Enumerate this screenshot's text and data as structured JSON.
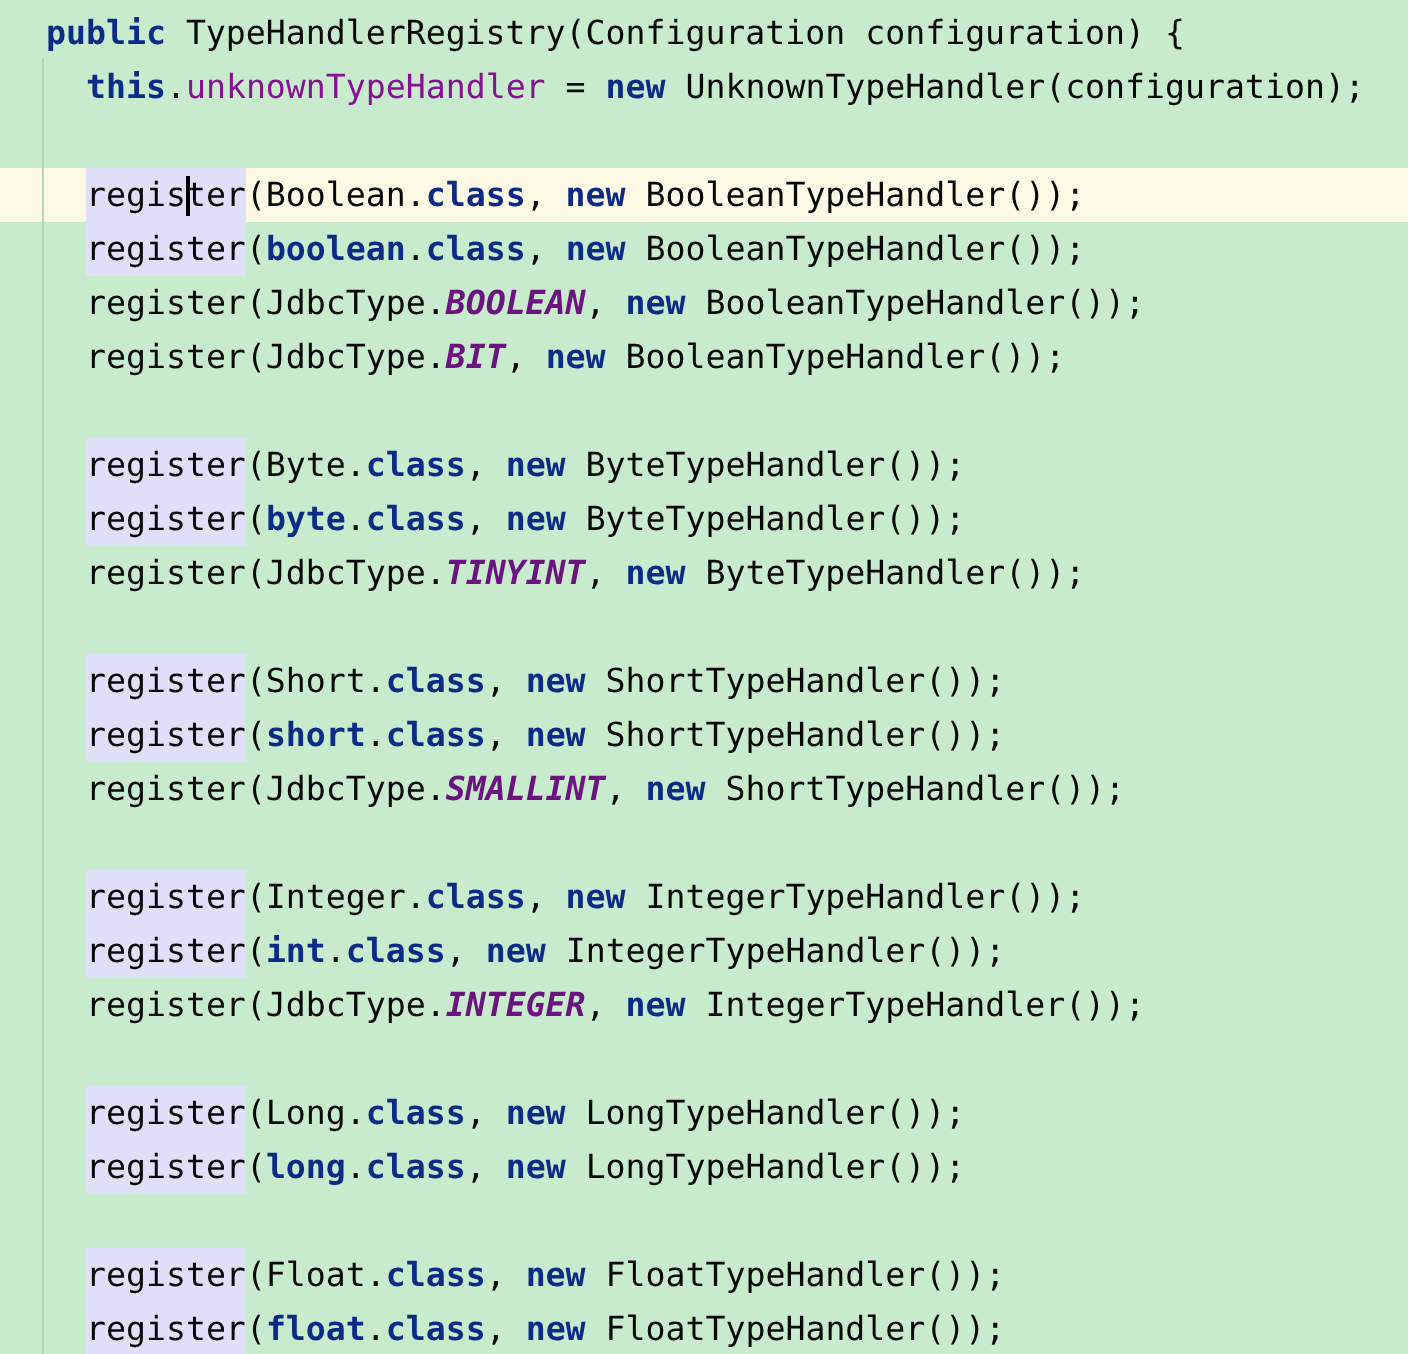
{
  "editor": {
    "signature": {
      "current": false,
      "tokens": [
        {
          "text": "public",
          "kind": "keyword"
        },
        {
          "text": " TypeHandlerRegistry(Configuration configuration) {",
          "kind": "plain"
        }
      ]
    },
    "body": [
      {
        "current": false,
        "call_highlighted": false,
        "tokens": [
          {
            "text": "this",
            "kind": "keyword"
          },
          {
            "text": ".",
            "kind": "plain"
          },
          {
            "text": "unknownTypeHandler",
            "kind": "field"
          },
          {
            "text": " = ",
            "kind": "plain"
          },
          {
            "text": "new",
            "kind": "keyword"
          },
          {
            "text": " UnknownTypeHandler(configuration);",
            "kind": "plain"
          }
        ]
      },
      {
        "current": false
      },
      {
        "current": true,
        "call_highlighted": true,
        "tokens": [
          {
            "text": "regis",
            "kind": "plain"
          },
          {
            "kind": "caret"
          },
          {
            "text": "ter",
            "kind": "plain"
          },
          {
            "text": "(Boolean.",
            "kind": "plain"
          },
          {
            "text": "class",
            "kind": "keyword"
          },
          {
            "text": ", ",
            "kind": "plain"
          },
          {
            "text": "new",
            "kind": "keyword"
          },
          {
            "text": " BooleanTypeHandler());",
            "kind": "plain"
          }
        ]
      },
      {
        "current": false,
        "call_highlighted": true,
        "tokens": [
          {
            "text": "register",
            "kind": "plain"
          },
          {
            "text": "(",
            "kind": "plain"
          },
          {
            "text": "boolean",
            "kind": "keyword"
          },
          {
            "text": ".",
            "kind": "plain"
          },
          {
            "text": "class",
            "kind": "keyword"
          },
          {
            "text": ", ",
            "kind": "plain"
          },
          {
            "text": "new",
            "kind": "keyword"
          },
          {
            "text": " BooleanTypeHandler());",
            "kind": "plain"
          }
        ]
      },
      {
        "current": false,
        "call_highlighted": false,
        "tokens": [
          {
            "text": "register",
            "kind": "plain"
          },
          {
            "text": "(JdbcType.",
            "kind": "plain"
          },
          {
            "text": "BOOLEAN",
            "kind": "constant"
          },
          {
            "text": ", ",
            "kind": "plain"
          },
          {
            "text": "new",
            "kind": "keyword"
          },
          {
            "text": " BooleanTypeHandler());",
            "kind": "plain"
          }
        ]
      },
      {
        "current": false,
        "call_highlighted": false,
        "tokens": [
          {
            "text": "register",
            "kind": "plain"
          },
          {
            "text": "(JdbcType.",
            "kind": "plain"
          },
          {
            "text": "BIT",
            "kind": "constant"
          },
          {
            "text": ", ",
            "kind": "plain"
          },
          {
            "text": "new",
            "kind": "keyword"
          },
          {
            "text": " BooleanTypeHandler());",
            "kind": "plain"
          }
        ]
      },
      {
        "current": false
      },
      {
        "current": false,
        "call_highlighted": true,
        "tokens": [
          {
            "text": "register",
            "kind": "plain"
          },
          {
            "text": "(Byte.",
            "kind": "plain"
          },
          {
            "text": "class",
            "kind": "keyword"
          },
          {
            "text": ", ",
            "kind": "plain"
          },
          {
            "text": "new",
            "kind": "keyword"
          },
          {
            "text": " ByteTypeHandler());",
            "kind": "plain"
          }
        ]
      },
      {
        "current": false,
        "call_highlighted": true,
        "tokens": [
          {
            "text": "register",
            "kind": "plain"
          },
          {
            "text": "(",
            "kind": "plain"
          },
          {
            "text": "byte",
            "kind": "keyword"
          },
          {
            "text": ".",
            "kind": "plain"
          },
          {
            "text": "class",
            "kind": "keyword"
          },
          {
            "text": ", ",
            "kind": "plain"
          },
          {
            "text": "new",
            "kind": "keyword"
          },
          {
            "text": " ByteTypeHandler());",
            "kind": "plain"
          }
        ]
      },
      {
        "current": false,
        "call_highlighted": false,
        "tokens": [
          {
            "text": "register",
            "kind": "plain"
          },
          {
            "text": "(JdbcType.",
            "kind": "plain"
          },
          {
            "text": "TINYINT",
            "kind": "constant"
          },
          {
            "text": ", ",
            "kind": "plain"
          },
          {
            "text": "new",
            "kind": "keyword"
          },
          {
            "text": " ByteTypeHandler());",
            "kind": "plain"
          }
        ]
      },
      {
        "current": false
      },
      {
        "current": false,
        "call_highlighted": true,
        "tokens": [
          {
            "text": "register",
            "kind": "plain"
          },
          {
            "text": "(Short.",
            "kind": "plain"
          },
          {
            "text": "class",
            "kind": "keyword"
          },
          {
            "text": ", ",
            "kind": "plain"
          },
          {
            "text": "new",
            "kind": "keyword"
          },
          {
            "text": " ShortTypeHandler());",
            "kind": "plain"
          }
        ]
      },
      {
        "current": false,
        "call_highlighted": true,
        "tokens": [
          {
            "text": "register",
            "kind": "plain"
          },
          {
            "text": "(",
            "kind": "plain"
          },
          {
            "text": "short",
            "kind": "keyword"
          },
          {
            "text": ".",
            "kind": "plain"
          },
          {
            "text": "class",
            "kind": "keyword"
          },
          {
            "text": ", ",
            "kind": "plain"
          },
          {
            "text": "new",
            "kind": "keyword"
          },
          {
            "text": " ShortTypeHandler());",
            "kind": "plain"
          }
        ]
      },
      {
        "current": false,
        "call_highlighted": false,
        "tokens": [
          {
            "text": "register",
            "kind": "plain"
          },
          {
            "text": "(JdbcType.",
            "kind": "plain"
          },
          {
            "text": "SMALLINT",
            "kind": "constant"
          },
          {
            "text": ", ",
            "kind": "plain"
          },
          {
            "text": "new",
            "kind": "keyword"
          },
          {
            "text": " ShortTypeHandler());",
            "kind": "plain"
          }
        ]
      },
      {
        "current": false
      },
      {
        "current": false,
        "call_highlighted": true,
        "tokens": [
          {
            "text": "register",
            "kind": "plain"
          },
          {
            "text": "(Integer.",
            "kind": "plain"
          },
          {
            "text": "class",
            "kind": "keyword"
          },
          {
            "text": ", ",
            "kind": "plain"
          },
          {
            "text": "new",
            "kind": "keyword"
          },
          {
            "text": " IntegerTypeHandler());",
            "kind": "plain"
          }
        ]
      },
      {
        "current": false,
        "call_highlighted": true,
        "tokens": [
          {
            "text": "register",
            "kind": "plain"
          },
          {
            "text": "(",
            "kind": "plain"
          },
          {
            "text": "int",
            "kind": "keyword"
          },
          {
            "text": ".",
            "kind": "plain"
          },
          {
            "text": "class",
            "kind": "keyword"
          },
          {
            "text": ", ",
            "kind": "plain"
          },
          {
            "text": "new",
            "kind": "keyword"
          },
          {
            "text": " IntegerTypeHandler());",
            "kind": "plain"
          }
        ]
      },
      {
        "current": false,
        "call_highlighted": false,
        "tokens": [
          {
            "text": "register",
            "kind": "plain"
          },
          {
            "text": "(JdbcType.",
            "kind": "plain"
          },
          {
            "text": "INTEGER",
            "kind": "constant"
          },
          {
            "text": ", ",
            "kind": "plain"
          },
          {
            "text": "new",
            "kind": "keyword"
          },
          {
            "text": " IntegerTypeHandler());",
            "kind": "plain"
          }
        ]
      },
      {
        "current": false
      },
      {
        "current": false,
        "call_highlighted": true,
        "tokens": [
          {
            "text": "register",
            "kind": "plain"
          },
          {
            "text": "(Long.",
            "kind": "plain"
          },
          {
            "text": "class",
            "kind": "keyword"
          },
          {
            "text": ", ",
            "kind": "plain"
          },
          {
            "text": "new",
            "kind": "keyword"
          },
          {
            "text": " LongTypeHandler());",
            "kind": "plain"
          }
        ]
      },
      {
        "current": false,
        "call_highlighted": true,
        "tokens": [
          {
            "text": "register",
            "kind": "plain"
          },
          {
            "text": "(",
            "kind": "plain"
          },
          {
            "text": "long",
            "kind": "keyword"
          },
          {
            "text": ".",
            "kind": "plain"
          },
          {
            "text": "class",
            "kind": "keyword"
          },
          {
            "text": ", ",
            "kind": "plain"
          },
          {
            "text": "new",
            "kind": "keyword"
          },
          {
            "text": " LongTypeHandler());",
            "kind": "plain"
          }
        ]
      },
      {
        "current": false
      },
      {
        "current": false,
        "call_highlighted": true,
        "tokens": [
          {
            "text": "register",
            "kind": "plain"
          },
          {
            "text": "(Float.",
            "kind": "plain"
          },
          {
            "text": "class",
            "kind": "keyword"
          },
          {
            "text": ", ",
            "kind": "plain"
          },
          {
            "text": "new",
            "kind": "keyword"
          },
          {
            "text": " FloatTypeHandler());",
            "kind": "plain"
          }
        ]
      },
      {
        "current": false,
        "call_highlighted": true,
        "tokens": [
          {
            "text": "register",
            "kind": "plain"
          },
          {
            "text": "(",
            "kind": "plain"
          },
          {
            "text": "float",
            "kind": "keyword"
          },
          {
            "text": ".",
            "kind": "plain"
          },
          {
            "text": "class",
            "kind": "keyword"
          },
          {
            "text": ", ",
            "kind": "plain"
          },
          {
            "text": "new",
            "kind": "keyword"
          },
          {
            "text": " FloatTypeHandler());",
            "kind": "plain"
          }
        ]
      }
    ]
  }
}
